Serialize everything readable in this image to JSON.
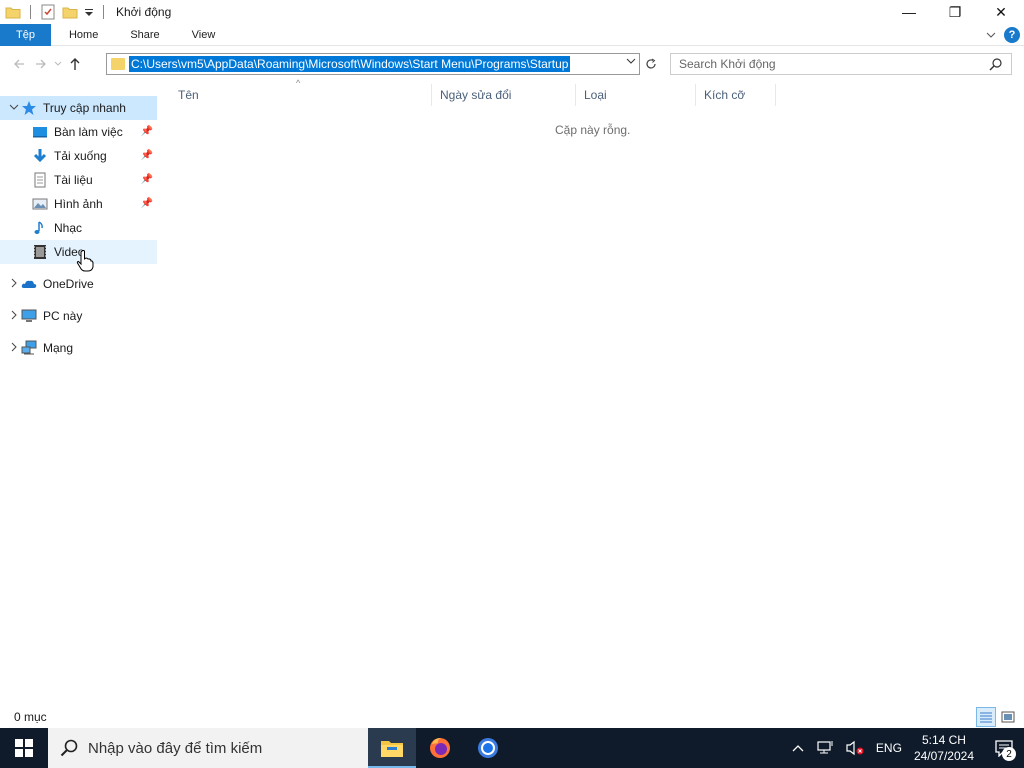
{
  "window": {
    "title": "Khởi động",
    "minimize_glyph": "—",
    "maximize_glyph": "❐",
    "close_glyph": "✕"
  },
  "ribbon": {
    "tabs": [
      {
        "label": "Tệp"
      },
      {
        "label": "Home"
      },
      {
        "label": "Share"
      },
      {
        "label": "View"
      }
    ],
    "help_glyph": "?"
  },
  "address": {
    "path": "C:\\Users\\vm5\\AppData\\Roaming\\Microsoft\\Windows\\Start Menu\\Programs\\Startup",
    "search_placeholder": "Search Khởi động"
  },
  "nav": {
    "quick_access": "Truy cập nhanh",
    "pinned": [
      {
        "label": "Bàn làm việc",
        "icon": "desktop-icon"
      },
      {
        "label": "Tải xuống",
        "icon": "download-icon"
      },
      {
        "label": "Tài liệu",
        "icon": "document-icon"
      },
      {
        "label": "Hình ảnh",
        "icon": "pictures-icon"
      }
    ],
    "others": [
      {
        "label": "Nhạc",
        "icon": "music-icon"
      },
      {
        "label": "Video",
        "icon": "video-icon"
      }
    ],
    "roots": [
      {
        "label": "OneDrive",
        "icon": "onedrive-icon"
      },
      {
        "label": "PC này",
        "icon": "this-pc-icon"
      },
      {
        "label": "Mạng",
        "icon": "network-icon"
      }
    ]
  },
  "content": {
    "columns": [
      "Tên",
      "Ngày sửa đổi",
      "Loại",
      "Kích cỡ"
    ],
    "empty_message": "Cặp này rỗng."
  },
  "status": {
    "item_count": "0 mục"
  },
  "taskbar": {
    "search_placeholder": "Nhập vào đây để tìm kiếm",
    "apps": [
      "file-explorer-icon",
      "firefox-icon",
      "chrome-icon"
    ],
    "language": "ENG",
    "time": "5:14 CH",
    "date": "24/07/2024",
    "notification_count": "2"
  },
  "colors": {
    "accent": "#1979ca",
    "selection": "#cce8ff",
    "taskbar": "#0f1b2a"
  }
}
